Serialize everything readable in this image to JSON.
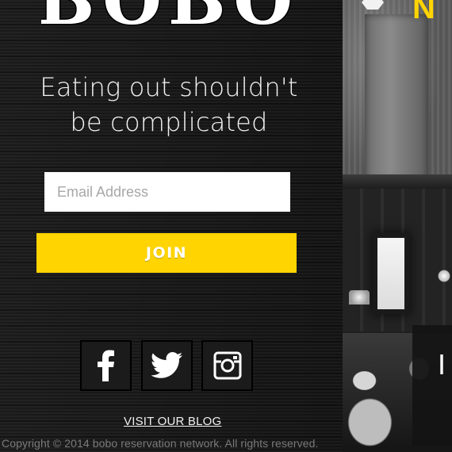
{
  "logo": {
    "text": "BOBO"
  },
  "tagline": {
    "line1": "Eating out shouldn't",
    "line2": "be complicated"
  },
  "signup": {
    "email_placeholder": "Email Address",
    "join_label": "JOIN"
  },
  "social": [
    {
      "name": "facebook",
      "glyph": "f"
    },
    {
      "name": "twitter",
      "glyph": "twitter-bird"
    },
    {
      "name": "instagram",
      "glyph": "camera"
    }
  ],
  "links": {
    "blog": "VISIT OUR BLOG"
  },
  "footer": {
    "copyright": "Copyright © 2014 bobo reservation network.   All rights reserved."
  },
  "photo_panel": {
    "brand_letter": "N",
    "card_glyph": "I"
  },
  "colors": {
    "accent": "#ffd400",
    "background": "#171717",
    "text": "#f2f2f2"
  }
}
